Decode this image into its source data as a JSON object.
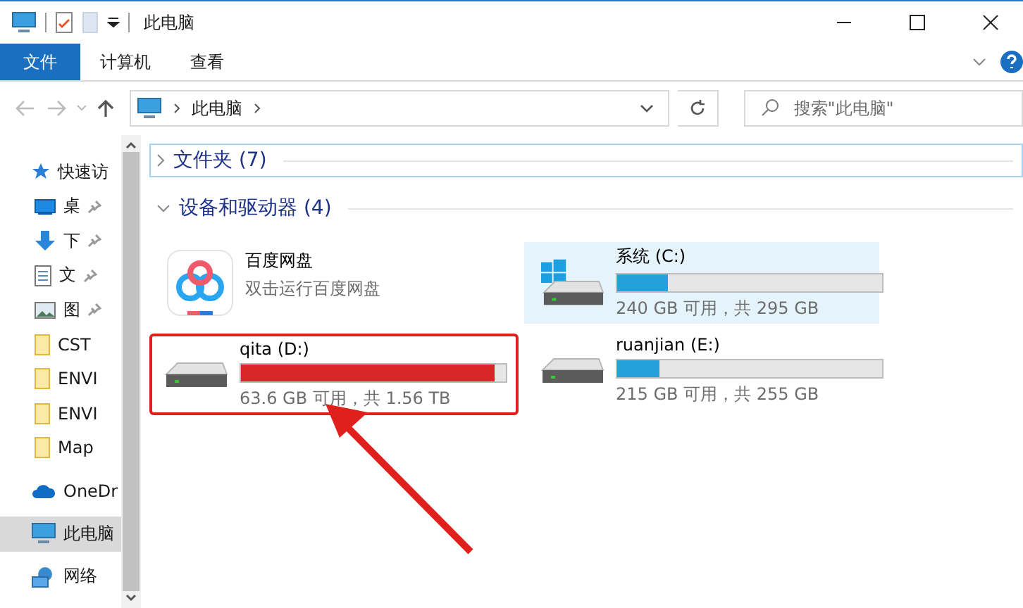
{
  "window": {
    "title": "此电脑"
  },
  "ribbon": {
    "tabs": [
      {
        "label": "文件",
        "kind": "file",
        "selected": true
      },
      {
        "label": "计算机",
        "kind": "tab",
        "selected": false
      },
      {
        "label": "查看",
        "kind": "tab",
        "selected": false
      }
    ]
  },
  "address_bar": {
    "path": "此电脑"
  },
  "search": {
    "placeholder": "搜索\"此电脑\""
  },
  "sidebar": {
    "items": [
      {
        "label": "快速访",
        "kind": "star",
        "pinned": false,
        "selected": false
      },
      {
        "label": "桌",
        "kind": "desktop",
        "pinned": true,
        "selected": false
      },
      {
        "label": "下",
        "kind": "download",
        "pinned": true,
        "selected": false
      },
      {
        "label": "文",
        "kind": "document",
        "pinned": true,
        "selected": false
      },
      {
        "label": "图",
        "kind": "image",
        "pinned": true,
        "selected": false
      },
      {
        "label": "CST",
        "kind": "folder",
        "pinned": false,
        "selected": false
      },
      {
        "label": "ENVI",
        "kind": "folder",
        "pinned": false,
        "selected": false
      },
      {
        "label": "ENVI",
        "kind": "folder",
        "pinned": false,
        "selected": false
      },
      {
        "label": "Map",
        "kind": "folder",
        "pinned": false,
        "selected": false
      },
      {
        "label": "OneDr",
        "kind": "cloud",
        "pinned": false,
        "selected": false
      },
      {
        "label": "此电脑",
        "kind": "pc",
        "pinned": false,
        "selected": true
      },
      {
        "label": "网络",
        "kind": "network",
        "pinned": false,
        "selected": false
      }
    ]
  },
  "groups": [
    {
      "title": "文件夹 (7)",
      "expanded": false
    },
    {
      "title": "设备和驱动器 (4)",
      "expanded": true,
      "items": [
        {
          "kind": "app",
          "name": "百度网盘",
          "subtitle": "双击运行百度网盘",
          "selected": false
        },
        {
          "kind": "drive",
          "system": true,
          "name": "系统 (C:)",
          "level": 0.19,
          "capacity": "240 GB 可用，共 295 GB",
          "selected": true,
          "highlighted": false
        },
        {
          "kind": "drive",
          "system": false,
          "name": "qita (D:)",
          "level": 0.96,
          "capacity": "63.6 GB 可用，共 1.56 TB",
          "selected": false,
          "highlighted": true
        },
        {
          "kind": "drive",
          "system": false,
          "name": "ruanjian (E:)",
          "level": 0.16,
          "capacity": "215 GB 可用，共 255 GB",
          "selected": false,
          "highlighted": false
        }
      ]
    }
  ]
}
